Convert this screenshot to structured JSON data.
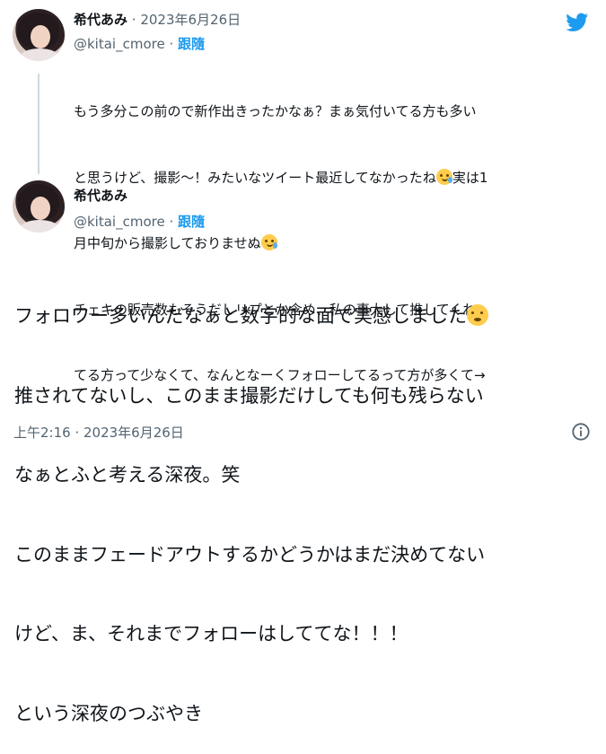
{
  "prev_tweet": {
    "author_name": "希代あみ",
    "date_sep": " · ",
    "date": "2023年6月26日",
    "handle": "@kitai_cmore",
    "follow_sep": " · ",
    "follow_label": "跟隨",
    "line1": "もう多分この前ので新作出きったかなぁ？まぁ気付いてる方も多い",
    "line2a": "と思うけど、撮影〜！みたいなツイート最近してなかったね",
    "line2b": "実は1",
    "line3a": "月中旬から撮影しておりませぬ",
    "line4": "チェキの販売数もそうだしリプとか含め、私の事大して推してくれ",
    "line5": "てる方って少なくて、なんとなーくフォローしてるって方が多くて→"
  },
  "main_tweet": {
    "author_name": "希代あみ",
    "handle": "@kitai_cmore",
    "follow_sep": " · ",
    "follow_label": "跟隨",
    "line1": "フォロワー多いんだなぁと数字的な面で実感しました",
    "line2": "推されてないし、このまま撮影だけしても何も残らない",
    "line3": "なぁとふと考える深夜。笑",
    "line4": "このままフェードアウトするかどうかはまだ決めてない",
    "line5": "けど、ま、それまでフォローはしててな！！！",
    "line6": "という深夜のつぶやき",
    "timestamp": "上午2:16 · 2023年6月26日"
  },
  "icons": {
    "brand": "twitter-bird-icon",
    "info": "info-icon",
    "emoji_tear_smile": "smiling-face-with-tear-icon",
    "emoji_pleading": "pleading-face-icon"
  },
  "colors": {
    "twitter_blue": "#1d9bf0",
    "text": "#0f1419",
    "muted": "#536471"
  }
}
